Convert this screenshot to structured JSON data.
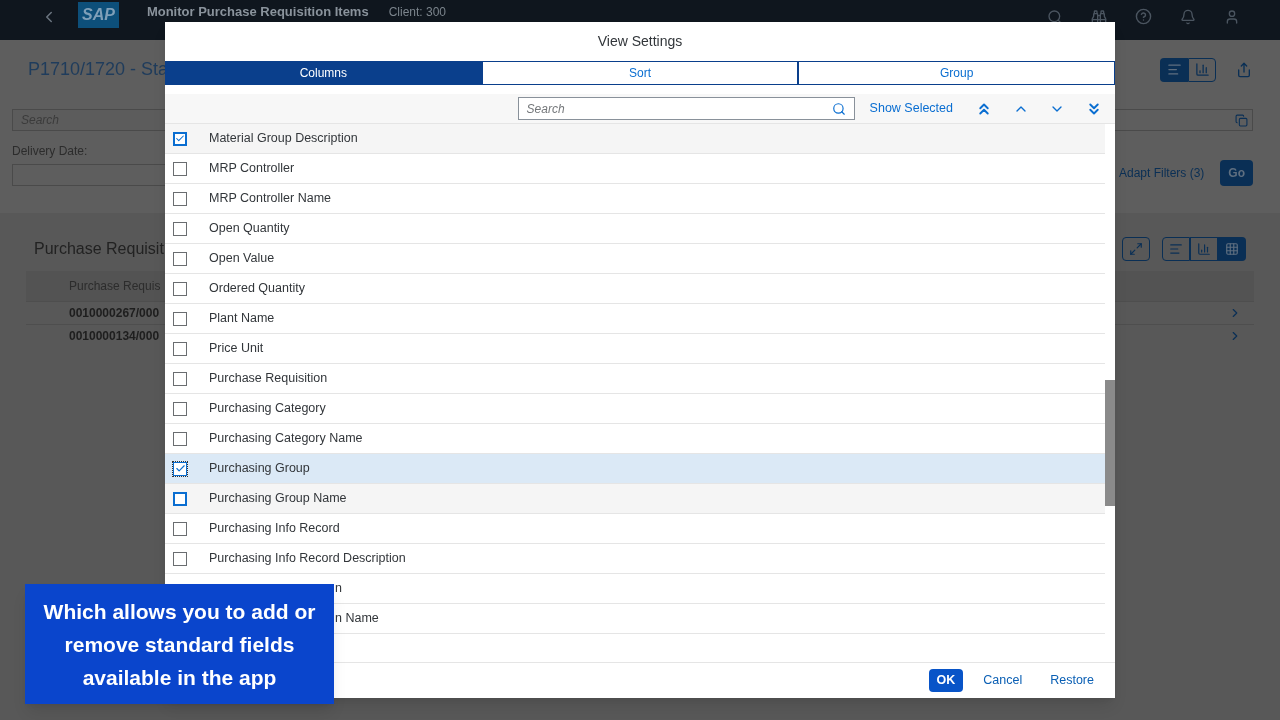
{
  "shell": {
    "logo": "SAP",
    "title": "Monitor Purchase Requisition Items",
    "client": "Client: 300"
  },
  "page": {
    "title": "P1710/1720 - Sta",
    "search_placeholder": "Search",
    "delivery_label": "Delivery Date:",
    "adapt_filters": "Adapt Filters (3)",
    "go": "Go",
    "section_title": "Purchase Requisit",
    "column_1": "Purchase Requis",
    "rows": [
      "0010000267/000",
      "0010000134/000"
    ]
  },
  "dialog": {
    "title": "View Settings",
    "tabs": [
      {
        "label": "Columns",
        "selected": true
      },
      {
        "label": "Sort",
        "selected": false
      },
      {
        "label": "Group",
        "selected": false
      }
    ],
    "search": {
      "placeholder": "Search"
    },
    "show_selected": "Show Selected",
    "items": [
      {
        "kind": "field",
        "label": "Material Group Description",
        "checked": true,
        "selected": false,
        "hovered": true
      },
      {
        "kind": "field",
        "label": "MRP Controller",
        "checked": false,
        "selected": false,
        "hovered": false
      },
      {
        "kind": "field",
        "label": "MRP Controller Name",
        "checked": false,
        "selected": false,
        "hovered": false
      },
      {
        "kind": "field",
        "label": "Open Quantity",
        "checked": false,
        "selected": false,
        "hovered": false
      },
      {
        "kind": "field",
        "label": "Open Value",
        "checked": false,
        "selected": false,
        "hovered": false
      },
      {
        "kind": "field",
        "label": "Ordered Quantity",
        "checked": false,
        "selected": false,
        "hovered": false
      },
      {
        "kind": "field",
        "label": "Plant Name",
        "checked": false,
        "selected": false,
        "hovered": false
      },
      {
        "kind": "field",
        "label": "Price Unit",
        "checked": false,
        "selected": false,
        "hovered": false
      },
      {
        "kind": "field",
        "label": "Purchase Requisition",
        "checked": false,
        "selected": false,
        "hovered": false
      },
      {
        "kind": "field",
        "label": "Purchasing Category",
        "checked": false,
        "selected": false,
        "hovered": false
      },
      {
        "kind": "field",
        "label": "Purchasing Category Name",
        "checked": false,
        "selected": false,
        "hovered": false
      },
      {
        "kind": "field",
        "label": "Purchasing Group",
        "checked": true,
        "selected": true,
        "hovered": false
      },
      {
        "kind": "field",
        "label": "Purchasing Group Name",
        "checked": false,
        "selected": false,
        "hovered": true
      },
      {
        "kind": "field",
        "label": "Purchasing Info Record",
        "checked": false,
        "selected": false,
        "hovered": false
      },
      {
        "kind": "field",
        "label": "Purchasing Info Record Description",
        "checked": false,
        "selected": false,
        "hovered": false
      },
      {
        "kind": "covered",
        "label": "n"
      },
      {
        "kind": "covered",
        "label": "n Name"
      }
    ],
    "buttons": [
      "OK",
      "Cancel",
      "Restore"
    ]
  },
  "caption": "Which allows you to add or remove standard fields available in the app"
}
